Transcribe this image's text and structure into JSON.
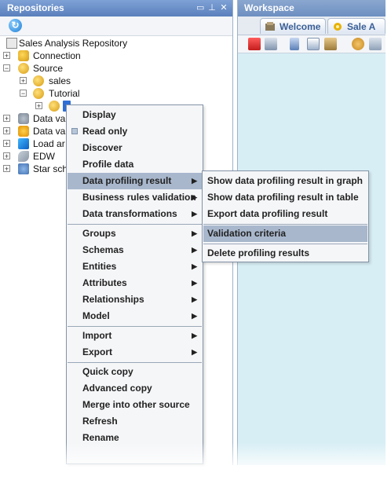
{
  "repositories": {
    "title": "Repositories",
    "header_icons": [
      "restore-icon",
      "pin-icon",
      "close-icon"
    ],
    "tree": [
      {
        "label": "Sales Analysis Repository",
        "icon": "repository-icon",
        "expander": ""
      },
      {
        "label": "Connection",
        "icon": "connection-icon",
        "expander": "+"
      },
      {
        "label": "Source",
        "icon": "source-icon",
        "expander": "−"
      },
      {
        "label": "sales",
        "icon": "source-icon",
        "expander": "+"
      },
      {
        "label": "Tutorial",
        "icon": "source-icon",
        "expander": "−"
      },
      {
        "label": "",
        "icon": "source-icon",
        "expander": "+"
      },
      {
        "label": "Data va",
        "icon": "data-vault-icon",
        "expander": "+"
      },
      {
        "label": "Data va",
        "icon": "data-vault-icon",
        "expander": "+"
      },
      {
        "label": "Load ar",
        "icon": "load-area-icon",
        "expander": "+"
      },
      {
        "label": "EDW",
        "icon": "edw-icon",
        "expander": "+"
      },
      {
        "label": "Star sch",
        "icon": "star-schema-icon",
        "expander": "+"
      }
    ]
  },
  "workspace": {
    "title": "Workspace",
    "tabs": [
      {
        "label": "Welcome"
      },
      {
        "label": "Sale A"
      }
    ]
  },
  "context_menu": {
    "items": [
      {
        "label": "Display",
        "submenu": false
      },
      {
        "label": "Read only",
        "submenu": false,
        "checkbox": true
      },
      {
        "label": "Discover",
        "submenu": false
      },
      {
        "label": "Profile data",
        "submenu": false
      },
      {
        "label": "Data profiling result",
        "submenu": true,
        "highlighted": true
      },
      {
        "label": "Business rules validation",
        "submenu": true
      },
      {
        "label": "Data transformations",
        "submenu": true
      },
      {
        "label": "Groups",
        "submenu": true
      },
      {
        "label": "Schemas",
        "submenu": true
      },
      {
        "label": "Entities",
        "submenu": true
      },
      {
        "label": "Attributes",
        "submenu": true
      },
      {
        "label": "Relationships",
        "submenu": true
      },
      {
        "label": "Model",
        "submenu": true
      },
      {
        "label": "Import",
        "submenu": true
      },
      {
        "label": "Export",
        "submenu": true
      },
      {
        "label": "Quick copy",
        "submenu": false
      },
      {
        "label": "Advanced copy",
        "submenu": false
      },
      {
        "label": "Merge into other source",
        "submenu": false
      },
      {
        "label": "Refresh",
        "submenu": false
      },
      {
        "label": "Rename",
        "submenu": false
      }
    ],
    "submenu": [
      {
        "label": "Show data profiling result in graph"
      },
      {
        "label": "Show data profiling result in table"
      },
      {
        "label": "Export data profiling result"
      },
      {
        "label": "Validation criteria",
        "highlighted": true
      },
      {
        "label": "Delete profiling results"
      }
    ]
  },
  "colors": {
    "header": "#6a8fc8",
    "workspace_bg": "#d7eef5",
    "menu_highlight": "#a8b7cc"
  }
}
